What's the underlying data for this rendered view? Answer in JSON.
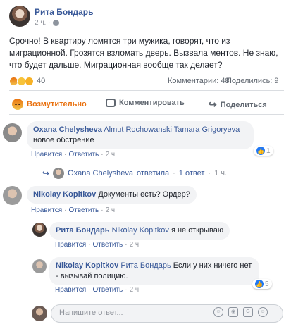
{
  "post": {
    "author": "Рита Бондарь",
    "time": "2 ч.",
    "text": "Срочно! В квартиру ломятся три мужика, говорят, что из миграционной. Грозятся взломать дверь. Вызвала ментов. Не знаю, что будет дальше. Миграционная вообще так делает?",
    "reaction_count": "40",
    "comments_count": "Комментарии: 48",
    "shares_count": "Поделились: 9"
  },
  "actions": {
    "angry": "Возмутительно",
    "comment": "Комментировать",
    "share": "Поделиться"
  },
  "comments": [
    {
      "name": "Oxana Chelysheva",
      "tags": "Almut Rochowanski Tamara Grigoryeva",
      "text": "новое обстрение",
      "like": "Нравится",
      "reply": "Ответить",
      "time": "2 ч.",
      "likes": "1",
      "reply_summary": {
        "name": "Oxana Chelysheva",
        "verb": "ответила",
        "count": "1 ответ",
        "time": "1 ч."
      }
    },
    {
      "name": "Nikolay Kopitkov",
      "text": "Документы есть? Ордер?",
      "like": "Нравится",
      "reply": "Ответить",
      "time": "2 ч."
    },
    {
      "name": "Рита Бондарь",
      "tags": "Nikolay Kopitkov",
      "text": "я не открываю",
      "like": "Нравится",
      "reply": "Ответить",
      "time": "2 ч."
    },
    {
      "name": "Nikolay Kopitkov",
      "tags": "Рита Бондарь",
      "text": "Если у них ничего нет - вызывай полицию.",
      "like": "Нравится",
      "reply": "Ответить",
      "time": "2 ч.",
      "likes": "5"
    }
  ],
  "composer": {
    "placeholder": "Напишите ответ..."
  },
  "icons": {
    "reactions": [
      "angry-icon",
      "sad-icon",
      "wow-icon"
    ],
    "composer": [
      "emoji-icon",
      "camera-icon",
      "gif-icon",
      "sticker-icon"
    ]
  },
  "colors": {
    "link": "#385898",
    "angry": "#e9710f",
    "like": "#2078f4"
  }
}
